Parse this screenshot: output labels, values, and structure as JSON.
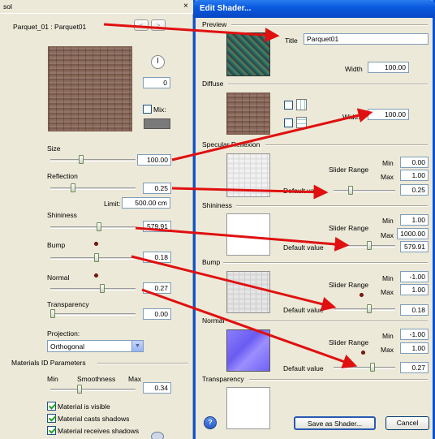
{
  "left_panel": {
    "title": "sol",
    "material_name": "Parquet_01 : Parquet01",
    "nav_prev": "<",
    "nav_next": ">",
    "rotation_value": "0",
    "mix_label": "Mix:",
    "size_label": "Size",
    "size_value": "100.00",
    "size_level": 0.35,
    "reflection_label": "Reflection",
    "reflection_value": "0.25",
    "reflection_level": 0.25,
    "limit_label": "Limit:",
    "limit_value": "500.00 cm",
    "shininess_label": "Shininess",
    "shininess_value": "579.91",
    "shininess_level": 0.58,
    "bump_label": "Bump",
    "bump_value": "0.18",
    "bump_level": 0.55,
    "normal_label": "Normal",
    "normal_value": "0.27",
    "normal_level": 0.62,
    "transparency_label": "Transparency",
    "transparency_value": "0.00",
    "transparency_level": 0.0,
    "projection_label": "Projection:",
    "projection_value": "Orthogonal",
    "materials_id_header": "Materials ID Parameters",
    "min_label": "Min",
    "smoothness_label": "Smoothness",
    "max_label": "Max",
    "smoothness_value": "0.34",
    "checkboxes": [
      {
        "label": "Material is visible",
        "checked": true
      },
      {
        "label": "Material casts shadows",
        "checked": true
      },
      {
        "label": "Material receives shadows",
        "checked": true
      }
    ]
  },
  "dialog": {
    "title": "Edit Shader...",
    "preview_header": "Preview",
    "title_label": "Title",
    "title_value": "Parquet01",
    "width_label": "Width",
    "preview_width_value": "100.00",
    "diffuse_header": "Diffuse",
    "diffuse_width_label": "Width",
    "diffuse_width_value": "100.00",
    "specular_header": "Specular Reflexion",
    "specular": {
      "min_label": "Min",
      "max_label": "Max",
      "range_label": "Slider Range",
      "default_label": "Default value",
      "min": "0.00",
      "max": "1.00",
      "default": "0.25",
      "level": 0.25
    },
    "shininess_header": "Shininess",
    "shininess": {
      "min_label": "Min",
      "max_label": "Max",
      "range_label": "Slider Range",
      "default_label": "Default value",
      "min": "1.00",
      "max": "1000.00",
      "default": "579.91",
      "level": 0.58
    },
    "bump_header": "Bump",
    "bump": {
      "min_label": "Min",
      "max_label": "Max",
      "range_label": "Slider Range",
      "default_label": "Default value",
      "min": "-1.00",
      "max": "1.00",
      "default": "0.18",
      "level": 0.59
    },
    "normal_header": "Normal",
    "normal": {
      "min_label": "Min",
      "max_label": "Max",
      "range_label": "Slider Range",
      "default_label": "Default value",
      "min": "-1.00",
      "max": "1.00",
      "default": "0.27",
      "level": 0.64
    },
    "transparency_header": "Transparency",
    "help_label": "?",
    "save_label": "Save as Shader...",
    "cancel_label": "Cancel"
  },
  "colors": {
    "arrow": "#e01010",
    "dialog_title_bar": "#0a5adf",
    "panel_bg": "#ece9d8"
  }
}
